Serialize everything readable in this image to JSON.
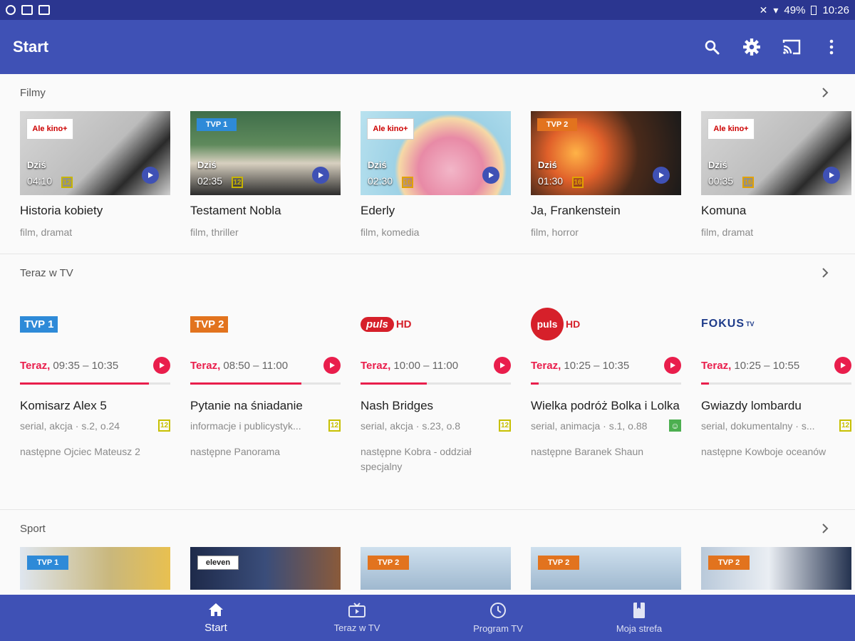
{
  "status": {
    "battery": "49%",
    "time": "10:26"
  },
  "appbar": {
    "title": "Start"
  },
  "films": {
    "title": "Filmy",
    "today_label": "Dziś",
    "items": [
      {
        "name": "Historia kobiety",
        "meta": "film, dramat",
        "time": "04:10",
        "age": "12",
        "channel": "Ale kino+"
      },
      {
        "name": "Testament Nobla",
        "meta": "film, thriller",
        "time": "02:35",
        "age": "12",
        "channel": "TVP 1"
      },
      {
        "name": "Ederly",
        "meta": "film, komedia",
        "time": "02:30",
        "age": "16",
        "channel": "Ale kino+"
      },
      {
        "name": "Ja, Frankenstein",
        "meta": "film, horror",
        "time": "01:30",
        "age": "16",
        "channel": "TVP 2"
      },
      {
        "name": "Komuna",
        "meta": "film, dramat",
        "time": "00:35",
        "age": "16",
        "channel": "Ale kino+"
      }
    ]
  },
  "tv": {
    "title": "Teraz w TV",
    "now_label": "Teraz,",
    "items": [
      {
        "logo": "TVP 1",
        "slot": "09:35 – 10:35",
        "progress": 0.86,
        "show": "Komisarz Alex 5",
        "genre": "serial, akcja · s.2, o.24",
        "badge": "12",
        "next": "następne Ojciec Mateusz 2"
      },
      {
        "logo": "TVP 2",
        "slot": "08:50 – 11:00",
        "progress": 0.74,
        "show": "Pytanie na śniadanie",
        "genre": "informacje i publicystyk...",
        "badge": "12",
        "next": "następne Panorama"
      },
      {
        "logo": "puls",
        "logo_sub": "HD",
        "slot": "10:00 – 11:00",
        "progress": 0.44,
        "show": "Nash Bridges",
        "genre": "serial, akcja · s.23, o.8",
        "badge": "12",
        "next": "następne Kobra - oddział specjalny"
      },
      {
        "logo": "puls",
        "logo_sub": "HD",
        "slot": "10:25 – 10:35",
        "progress": 0.05,
        "show": "Wielka podróż Bolka i Lolka",
        "genre": "serial, animacja · s.1, o.88",
        "badge": "☺",
        "next": "następne Baranek Shaun"
      },
      {
        "logo": "FOKUS",
        "logo_sub": "TV",
        "slot": "10:25 – 10:55",
        "progress": 0.05,
        "show": "Gwiazdy lombardu",
        "genre": "serial, dokumentalny · s...",
        "badge": "12",
        "next": "następne Kowboje oceanów"
      }
    ]
  },
  "sport": {
    "title": "Sport",
    "items": [
      {
        "channel": "TVP 1"
      },
      {
        "channel": "eleven"
      },
      {
        "channel": "TVP 2"
      },
      {
        "channel": "TVP 2"
      },
      {
        "channel": "TVP 2"
      }
    ]
  },
  "nav": {
    "items": [
      {
        "label": "Start",
        "icon": "home-icon",
        "active": true
      },
      {
        "label": "Teraz w TV",
        "icon": "tv-icon",
        "active": false
      },
      {
        "label": "Program TV",
        "icon": "clock-icon",
        "active": false
      },
      {
        "label": "Moja strefa",
        "icon": "bookmark-icon",
        "active": false
      }
    ]
  },
  "colors": {
    "primary": "#3f51b5",
    "statusbar": "#2b3690",
    "accent": "#e91e4c"
  }
}
